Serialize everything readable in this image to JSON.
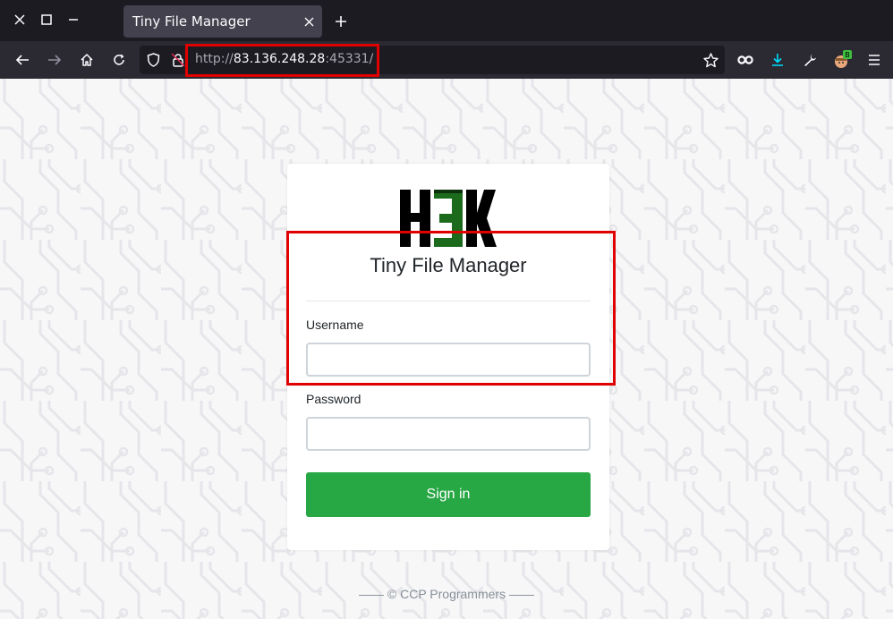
{
  "window": {
    "buttons": [
      "close-icon",
      "maximize-icon",
      "minimize-icon"
    ]
  },
  "tab": {
    "title": "Tiny File Manager"
  },
  "urlbar": {
    "scheme": "http://",
    "host": "83.136.248.28",
    "port": ":45331/"
  },
  "extensions": {
    "badge": "B"
  },
  "login": {
    "logo_text": "H3K",
    "title": "Tiny File Manager",
    "username_label": "Username",
    "username_value": "",
    "password_label": "Password",
    "password_value": "",
    "signin_label": "Sign in"
  },
  "footer": {
    "text": "—— © CCP Programmers ——"
  },
  "colors": {
    "chrome_dark": "#1c1b22",
    "toolbar": "#2b2a33",
    "tab_active": "#42414d",
    "signin_green": "#28a745",
    "highlight_red": "#e00000",
    "logo_green": "#1c6b1c"
  }
}
